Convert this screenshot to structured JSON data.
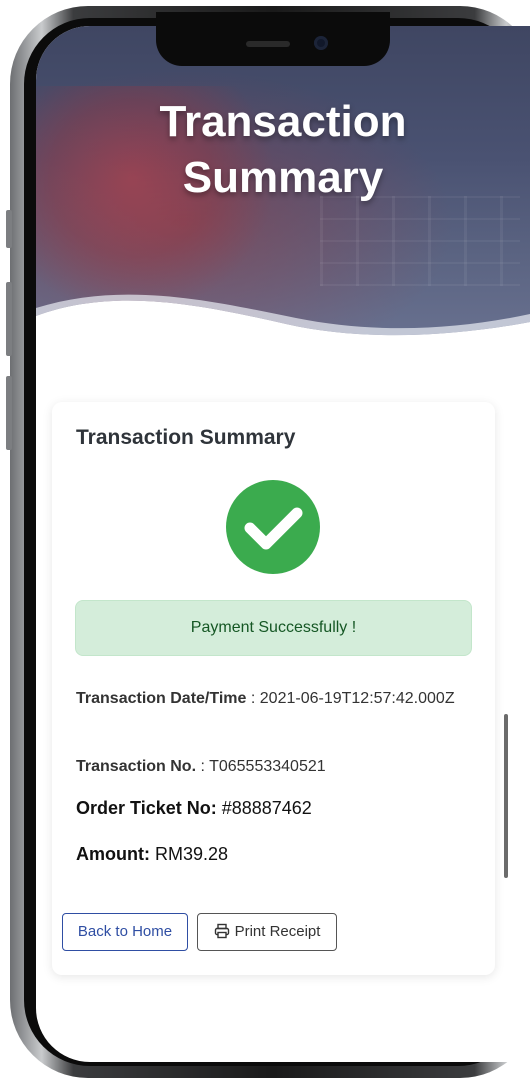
{
  "hero": {
    "title": "Transaction Summary"
  },
  "card": {
    "title": "Transaction Summary",
    "status_message": "Payment Successfully !",
    "fields": {
      "datetime_label": "Transaction Date/Time",
      "datetime_value": " : 2021-06-19T12:57:42.000Z",
      "txn_no_label": "Transaction No.",
      "txn_no_value": " : T065553340521",
      "ticket_label": "Order Ticket No:",
      "ticket_value": " #88887462",
      "amount_label": "Amount:",
      "amount_value": " RM39.28"
    },
    "buttons": {
      "back_home": "Back to Home",
      "print_receipt": "Print Receipt"
    }
  },
  "icons": {
    "success": "check-circle-icon",
    "print": "printer-icon"
  },
  "colors": {
    "success_green": "#3bab4e",
    "alert_bg": "#d4edda",
    "alert_text": "#155724",
    "primary_outline": "#2f4ea3",
    "hero_overlay": "#4a5272"
  }
}
